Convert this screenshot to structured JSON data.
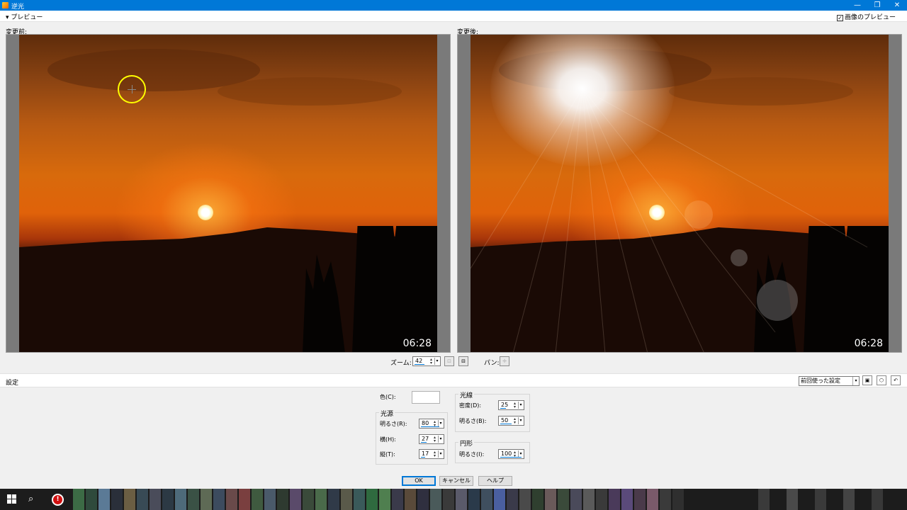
{
  "window": {
    "title": "逆光",
    "minimize": "—",
    "restore": "❐",
    "close": "✕"
  },
  "preview": {
    "toggle_label": "プレビュー",
    "image_preview_label": "画像のプレビュー",
    "image_preview_checked": true
  },
  "panes": {
    "before_label": "変更前:",
    "after_label": "変更後:",
    "timestamp": "06:28"
  },
  "zoom": {
    "label": "ズーム:",
    "value": "42",
    "pan_label": "パン:"
  },
  "settings": {
    "label": "設定",
    "preset": "前回使った設定",
    "color_label": "色(C):",
    "light_source": {
      "title": "光源",
      "brightness_label": "明るさ(R):",
      "brightness": "80",
      "horizontal_label": "横(H):",
      "horizontal": "27",
      "vertical_label": "縦(T):",
      "vertical": "17"
    },
    "rays": {
      "title": "光線",
      "density_label": "密度(D):",
      "density": "25",
      "brightness_label": "明るさ(B):",
      "brightness": "50"
    },
    "circle": {
      "title": "円形",
      "brightness_label": "明るさ(I):",
      "brightness": "100"
    }
  },
  "buttons": {
    "ok": "OK",
    "cancel": "キャンセル",
    "help": "ヘルプ"
  },
  "colors": {
    "titlebar": "#0078d7",
    "dialog_bg": "#f0f0f0",
    "taskbar": "#1c1c1c"
  }
}
